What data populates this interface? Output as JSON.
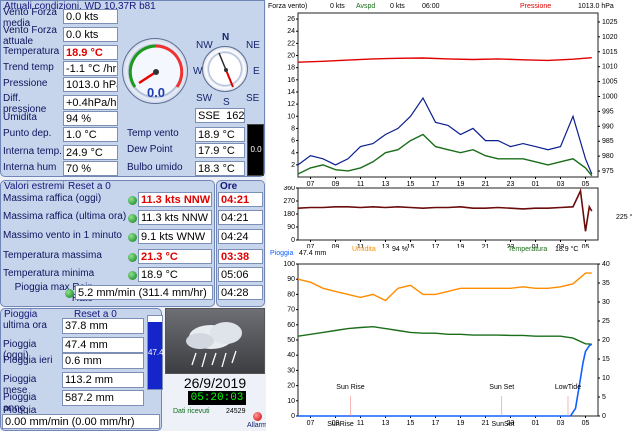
{
  "conditions": {
    "title": "Attuali condizioni, WD 10.37R b81",
    "rows": [
      {
        "label": "Vento Forza media",
        "value": "0.0 kts"
      },
      {
        "label": "Vento Forza attuale",
        "value": "0.0 kts"
      },
      {
        "label": "Temperatura",
        "value": "18.9 °C"
      },
      {
        "label": "Trend temp",
        "value": "-1.1 °C /hr"
      },
      {
        "label": "Pressione",
        "value": "1013.0 hPa"
      },
      {
        "label": "Diff. pressione",
        "value": "+0.4hPa/hr"
      },
      {
        "label": "Umidita",
        "value": "94 %"
      },
      {
        "label": "Punto dep.",
        "value": "1.0 °C"
      },
      {
        "label": "Interna temp.",
        "value": "24.9 °C"
      },
      {
        "label": "Interna hum",
        "value": "70 %"
      }
    ],
    "wind_speed_dial": "0.0",
    "compass": {
      "n": "N",
      "ne": "NE",
      "e": "E",
      "se": "SE",
      "s": "S",
      "sw": "SW",
      "w": "W",
      "nw": "NW"
    },
    "wind_direction": "SSE",
    "wind_degrees": "162 °",
    "secondary": [
      {
        "label": "Temp vento",
        "value": "18.9 °C"
      },
      {
        "label": "Dew Point",
        "value": "17.9 °C"
      },
      {
        "label": "Bulbo umido",
        "value": "18.3 °C"
      }
    ],
    "bar_value": "0.0"
  },
  "extremes": {
    "title": "Valori estremi",
    "reset": "Reset a 0",
    "time_header": "Ore",
    "rows": [
      {
        "label": "Massima raffica (oggi)",
        "value": "11.3 kts NNW",
        "time": "04:21"
      },
      {
        "label": "Massima raffica (ultima ora)",
        "value": "11.3 kts NNW",
        "time": "04:21"
      },
      {
        "label": "Massimo vento in 1 minuto",
        "value": "9.1 kts WNW",
        "time": "04:24"
      },
      {
        "label": "Temperatura massima",
        "value": "21.3 °C",
        "time": "03:38"
      },
      {
        "label": "Temperatura minima",
        "value": "18.9 °C",
        "time": "05:06"
      },
      {
        "label": "Pioggia max Rain Rate",
        "value": "5.2 mm/min (311.4 mm/hr)",
        "time": "04:28"
      }
    ]
  },
  "rain": {
    "title": "Pioggia",
    "reset": "Reset a 0",
    "rows": [
      {
        "label": "ultima ora",
        "value": "37.8 mm"
      },
      {
        "label": "Pioggia (oggi)",
        "value": "47.4 mm"
      },
      {
        "label": "Pioggia ieri",
        "value": "0.6 mm"
      },
      {
        "label": "Pioggia mese",
        "value": "113.2 mm"
      },
      {
        "label": "Pioggia anno",
        "value": "587.2 mm"
      }
    ],
    "rate_label": "Pioggia",
    "rate_value": "0.00 mm/min (0.00 mm/hr)",
    "gauge_value": "47.4",
    "date": "26/9/2019",
    "time": "05:20:03",
    "data_received_label": "Dati ricevuti",
    "data_received_count": "24529",
    "alarm_label": "Allarmi"
  },
  "colors": {
    "wind_avg": "#0a1f8f",
    "gust": "#0a1f8f",
    "wind_green": "#1a6e1a",
    "pressure": "#e00000",
    "direction": "#6b0b0b",
    "humidity": "#ff8c00",
    "temperature": "#1a6e1a",
    "rain": "#1060ff"
  },
  "chart_data": [
    {
      "type": "line",
      "title": "",
      "header": {
        "forza_label": "Forza vento)",
        "forza_value": "0 kts",
        "avspd_label": "Avspd",
        "avspd_value": "0 kts",
        "time": "06:00",
        "pressione_label": "Pressione",
        "pressione_value": "1013.0 hPa"
      },
      "x_ticks": [
        "07",
        "09",
        "11",
        "13",
        "15",
        "17",
        "19",
        "21",
        "23",
        "01",
        "03",
        "05"
      ],
      "y_left_ticks": [
        2,
        4,
        6,
        8,
        10,
        12,
        14,
        16,
        18,
        20,
        22,
        24,
        26
      ],
      "y_right_ticks": [
        975,
        980,
        985,
        990,
        995,
        1000,
        1005,
        1010,
        1015,
        1020,
        1025
      ],
      "ylim_left": [
        0,
        27
      ],
      "ylim_right": [
        973,
        1028
      ],
      "series": [
        {
          "name": "Pressione",
          "axis": "right",
          "x": [
            6,
            8,
            10,
            12,
            14,
            16,
            18,
            20,
            22,
            24,
            26,
            28,
            29.5
          ],
          "values": [
            1011.5,
            1011.8,
            1012.2,
            1012.6,
            1012.8,
            1012.9,
            1012.6,
            1012.4,
            1012.6,
            1012.3,
            1012.1,
            1012.5,
            1013.0
          ]
        },
        {
          "name": "Avspd",
          "axis": "left",
          "x": [
            6,
            7,
            8,
            9,
            10,
            11,
            12,
            13,
            14,
            15,
            16,
            17,
            18,
            19,
            20,
            21,
            22,
            23,
            24,
            25,
            26,
            27,
            28,
            29,
            29.5
          ],
          "values": [
            0.5,
            1.5,
            2,
            1.2,
            1,
            1.5,
            2.5,
            4,
            4.5,
            6,
            7,
            5,
            4.5,
            4,
            4.5,
            3.5,
            3,
            3,
            3,
            2.5,
            2,
            2.5,
            3,
            1.5,
            0.2
          ]
        },
        {
          "name": "Forza vento",
          "axis": "left",
          "x": [
            6,
            7,
            8,
            9,
            10,
            11,
            12,
            13,
            14,
            15,
            16,
            17,
            18,
            19,
            20,
            21,
            22,
            23,
            24,
            25,
            26,
            27,
            28,
            29,
            29.5
          ],
          "values": [
            2,
            3.5,
            3,
            2,
            3,
            5,
            5.5,
            7,
            8,
            10,
            13,
            9,
            8.5,
            7,
            8,
            6,
            6,
            5,
            5.5,
            5,
            4.5,
            5,
            10,
            3,
            0.5
          ]
        }
      ]
    },
    {
      "type": "line",
      "title": "",
      "x_ticks": [
        "07",
        "09",
        "11",
        "13",
        "15",
        "17",
        "19",
        "21",
        "23",
        "01",
        "03",
        "05"
      ],
      "y_ticks": [
        0,
        90,
        180,
        270,
        360
      ],
      "ylim": [
        0,
        360
      ],
      "right_label": "225 °",
      "series": [
        {
          "name": "Direzione",
          "x": [
            6,
            7,
            8,
            9,
            10,
            11,
            12,
            13,
            14,
            15,
            16,
            17,
            18,
            19,
            20,
            21,
            22,
            23,
            24,
            25,
            26,
            27,
            28,
            28.6,
            29,
            29.3,
            29.5
          ],
          "values": [
            220,
            225,
            225,
            230,
            230,
            225,
            230,
            225,
            230,
            225,
            220,
            225,
            225,
            230,
            220,
            220,
            225,
            220,
            215,
            220,
            220,
            225,
            230,
            340,
            60,
            230,
            200
          ]
        }
      ]
    },
    {
      "type": "line",
      "title": "",
      "header": {
        "pioggia_label": "Pioggia",
        "pioggia_value": "47.4 mm",
        "umidita_label": "Umidita",
        "umidita_value": "94 %",
        "temp_label": "Temperatura",
        "temp_value": "18.9 °C"
      },
      "x_ticks": [
        "07",
        "09",
        "11",
        "13",
        "15",
        "17",
        "19",
        "21",
        "23",
        "01",
        "03",
        "05"
      ],
      "y_left_ticks": [
        0,
        10,
        20,
        30,
        40,
        50,
        60,
        70,
        80,
        90,
        100
      ],
      "y_right_ticks": [
        0,
        5,
        10,
        15,
        20,
        25,
        30,
        35,
        40
      ],
      "ylim_left": [
        0,
        100
      ],
      "ylim_right": [
        0,
        40
      ],
      "annotations": [
        "Sun Rise",
        "Sun Set",
        "LowTide",
        "SunRise",
        "SunSet"
      ],
      "series": [
        {
          "name": "Umidita",
          "axis": "left",
          "x": [
            6,
            7,
            8,
            9,
            10,
            11,
            12,
            13,
            14,
            15,
            16,
            17,
            18,
            19,
            20,
            21,
            22,
            23,
            24,
            25,
            26,
            27,
            28,
            29,
            29.5
          ],
          "values": [
            90,
            88,
            84,
            82,
            80,
            78,
            80,
            76,
            84,
            86,
            80,
            80,
            82,
            84,
            84,
            84,
            84,
            84,
            85,
            84,
            84,
            85,
            87,
            94,
            94
          ]
        },
        {
          "name": "Temperatura",
          "axis": "right",
          "x": [
            6,
            7,
            8,
            9,
            10,
            11,
            12,
            13,
            14,
            15,
            16,
            17,
            18,
            19,
            20,
            21,
            22,
            23,
            24,
            25,
            26,
            27,
            28,
            29,
            29.5
          ],
          "values": [
            21,
            21.5,
            22,
            22.5,
            23,
            23.3,
            23.5,
            23,
            22.5,
            22,
            21.8,
            21.8,
            21.5,
            21.5,
            21.3,
            21.3,
            21.3,
            21.2,
            21.2,
            21,
            21,
            21,
            20.5,
            19,
            18.9
          ]
        },
        {
          "name": "Pioggia",
          "axis": "right",
          "x": [
            6,
            8,
            10,
            12,
            14,
            16,
            18,
            20,
            22,
            24,
            26,
            27.8,
            28.2,
            28.5,
            28.8,
            29,
            29.3,
            29.5
          ],
          "values": [
            0,
            0,
            0,
            0,
            0,
            0,
            0,
            0,
            0,
            0,
            0,
            0,
            2,
            8,
            14,
            17,
            18.5,
            18.9
          ]
        }
      ]
    }
  ]
}
